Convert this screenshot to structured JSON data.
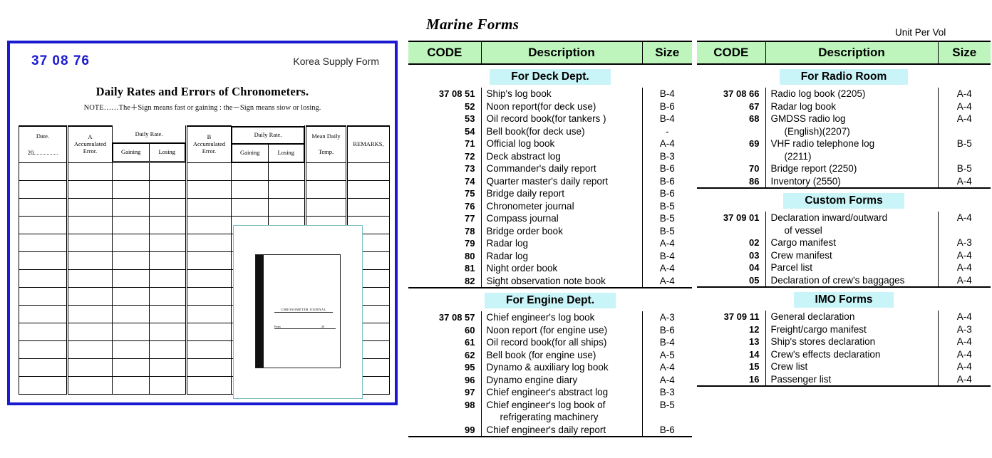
{
  "page": {
    "marine_title": "Marine Forms",
    "unit_per_vol": "Unit Per Vol"
  },
  "sample_form": {
    "code": "37 08 76",
    "origin": "Korea Supply Form",
    "title": "Daily Rates and Errors of Chronometers.",
    "note": "NOTE……The＋Sign means fast or gaining : the－Sign means siow or losing.",
    "columns": {
      "date": "Date.",
      "date_year": "20",
      "a_accumulated": "A\nAccumulated\nError.",
      "a_label_1": "A",
      "a_label_2": "Accumulated",
      "a_label_3": "Error.",
      "daily_rate": "Daily Rate.",
      "gaining": "Gaining",
      "losing": "Losing",
      "b_label_1": "B",
      "b_label_2": "Accumulated",
      "b_label_3": "Error.",
      "mean_daily": "Mean Daily",
      "temp": "Temp.",
      "remarks": "REMARKS,"
    },
    "book_photo": {
      "cover_title": "CHRONOMETER  JOURNAL",
      "cover_from": "From",
      "cover_to": "20"
    }
  },
  "catalog": {
    "header": {
      "code": "CODE",
      "description": "Description",
      "size": "Size"
    },
    "middle_column": [
      {
        "section": "For Deck Dept.",
        "rows": [
          {
            "code": "37 08 51",
            "description": "Ship's log book",
            "size": "B-4"
          },
          {
            "code": "52",
            "description": "Noon report(for deck use)",
            "size": "B-6"
          },
          {
            "code": "53",
            "description": "Oil record book(for tankers )",
            "size": "B-4"
          },
          {
            "code": "54",
            "description": "Bell book(for deck use)",
            "size": "-"
          },
          {
            "code": "71",
            "description": "Official log book",
            "size": "A-4"
          },
          {
            "code": "72",
            "description": "Deck abstract log",
            "size": "B-3"
          },
          {
            "code": "73",
            "description": "Commander's daily report",
            "size": "B-6"
          },
          {
            "code": "74",
            "description": "Quarter master's daily report",
            "size": "B-6"
          },
          {
            "code": "75",
            "description": "Bridge daily report",
            "size": "B-6"
          },
          {
            "code": "76",
            "description": "Chronometer journal",
            "size": "B-5"
          },
          {
            "code": "77",
            "description": "Compass journal",
            "size": "B-5"
          },
          {
            "code": "78",
            "description": "Bridge  order book",
            "size": "B-5"
          },
          {
            "code": "79",
            "description": "Radar log",
            "size": "A-4"
          },
          {
            "code": "80",
            "description": "Radar log",
            "size": "B-4"
          },
          {
            "code": "81",
            "description": "Night order book",
            "size": "A-4"
          },
          {
            "code": "82",
            "description": "Sight observation note book",
            "size": "A-4"
          }
        ]
      },
      {
        "section": "For Engine Dept.",
        "rows": [
          {
            "code": "37 08 57",
            "description": "Chief engineer's log book",
            "size": "A-3"
          },
          {
            "code": "60",
            "description": "Noon report (for engine use)",
            "size": "B-6"
          },
          {
            "code": "61",
            "description": "Oil record book(for all ships)",
            "size": "B-4"
          },
          {
            "code": "62",
            "description": "Bell book (for engine use)",
            "size": "A-5"
          },
          {
            "code": "95",
            "description": "Dynamo & auxiliary log book",
            "size": "A-4"
          },
          {
            "code": "96",
            "description": "Dynamo engine diary",
            "size": "A-4"
          },
          {
            "code": "97",
            "description": "Chief engineer's abstract log",
            "size": "B-3"
          },
          {
            "code": "98",
            "description": "Chief engineer's log book of",
            "size": "B-5"
          },
          {
            "code": "",
            "description": "refrigerating machinery",
            "size": "",
            "cont": true
          },
          {
            "code": "99",
            "description": "Chief engineer's daily report",
            "size": "B-6"
          }
        ]
      }
    ],
    "right_column": [
      {
        "section": "For Radio Room",
        "rows": [
          {
            "code": "37 08 66",
            "description": "Radio log book (2205)",
            "size": "A-4"
          },
          {
            "code": "67",
            "description": "Radar log book",
            "size": "A-4"
          },
          {
            "code": "68",
            "description": "GMDSS radio log",
            "size": "A-4"
          },
          {
            "code": "",
            "description": "(English)(2207)",
            "size": "",
            "cont": true
          },
          {
            "code": "69",
            "description": "VHF radio telephone log",
            "size": "B-5"
          },
          {
            "code": "",
            "description": "(2211)",
            "size": "",
            "cont": true
          },
          {
            "code": "70",
            "description": "Bridge report (2250)",
            "size": "B-5"
          },
          {
            "code": "86",
            "description": "Inventory (2550)",
            "size": "A-4"
          }
        ]
      },
      {
        "section": "Custom Forms",
        "rows": [
          {
            "code": "37 09 01",
            "description": "Declaration inward/outward",
            "size": "A-4"
          },
          {
            "code": "",
            "description": "of vessel",
            "size": "",
            "cont": true
          },
          {
            "code": "02",
            "description": "Cargo manifest",
            "size": "A-3"
          },
          {
            "code": "03",
            "description": "Crew manifest",
            "size": "A-4"
          },
          {
            "code": "04",
            "description": "Parcel list",
            "size": "A-4"
          },
          {
            "code": "05",
            "description": "Declaration of crew's baggages",
            "size": "A-4"
          }
        ]
      },
      {
        "section": "IMO Forms",
        "rows": [
          {
            "code": "37 09 11",
            "description": "General declaration",
            "size": "A-4"
          },
          {
            "code": "12",
            "description": "Freight/cargo manifest",
            "size": "A-3"
          },
          {
            "code": "13",
            "description": "Ship's stores declaration",
            "size": "A-4"
          },
          {
            "code": "14",
            "description": "Crew's effects declaration",
            "size": "A-4"
          },
          {
            "code": "15",
            "description": "Crew list",
            "size": "A-4"
          },
          {
            "code": "16",
            "description": "Passenger list",
            "size": "A-4"
          }
        ]
      }
    ]
  },
  "colors": {
    "header_green": "#bdf5bd",
    "section_cyan": "#c9f4f8",
    "form_border_blue": "#1a1ad0",
    "form_code_blue": "#1a1ad0"
  }
}
